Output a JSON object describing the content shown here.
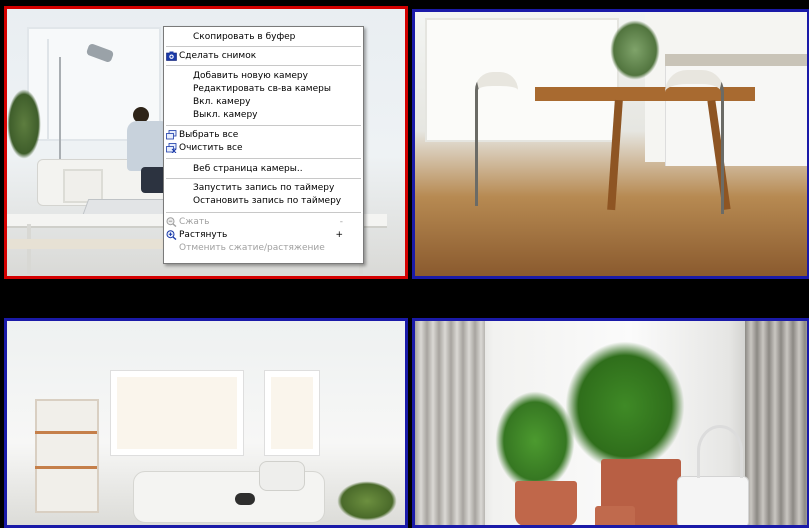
{
  "cameras": [
    {
      "id": "cam1",
      "scene": "living-room",
      "selected": true
    },
    {
      "id": "cam2",
      "scene": "dining-room",
      "selected": false
    },
    {
      "id": "cam3",
      "scene": "white-room",
      "selected": false
    },
    {
      "id": "cam4",
      "scene": "plants",
      "selected": false
    }
  ],
  "colors": {
    "selected_border": "#d40000",
    "normal_border": "#1a1aa8",
    "background": "#000000"
  },
  "context_menu": {
    "copy_buffer": "Скопировать в буфер",
    "snapshot": "Сделать снимок",
    "add_camera": "Добавить новую камеру",
    "edit_camera": "Редактировать св-ва камеры",
    "camera_on": "Вкл. камеру",
    "camera_off": "Выкл. камеру",
    "select_all": "Выбрать все",
    "clear_all": "Очистить все",
    "web_page": "Веб страница камеры..",
    "start_timer_rec": "Запустить запись по таймеру",
    "stop_timer_rec": "Остановить запись по таймеру",
    "shrink": "Сжать",
    "shrink_shortcut": "-",
    "stretch": "Растянуть",
    "stretch_shortcut": "+",
    "cancel_stretch": "Отменить сжатие/растяжение"
  }
}
